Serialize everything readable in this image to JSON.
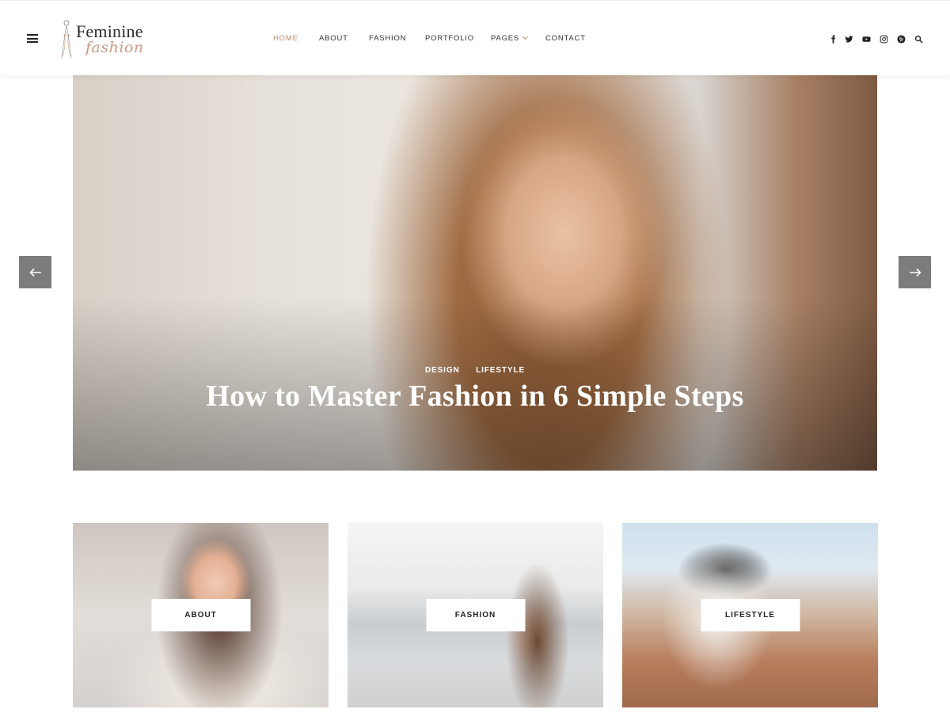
{
  "brand": {
    "name_line1": "Feminine",
    "name_line2": "fashion",
    "accent_color": "#c58b68"
  },
  "header": {
    "menu_icon": "hamburger-menu-icon",
    "nav": [
      {
        "label": "HOME",
        "active": true
      },
      {
        "label": "ABOUT",
        "active": false
      },
      {
        "label": "FASHION",
        "active": false
      },
      {
        "label": "PORTFOLIO",
        "active": false
      },
      {
        "label": "PAGES",
        "active": false,
        "has_dropdown": true
      },
      {
        "label": "CONTACT",
        "active": false
      }
    ],
    "social_icons": [
      "facebook-icon",
      "twitter-icon",
      "youtube-icon",
      "instagram-icon",
      "pinterest-icon",
      "search-icon"
    ]
  },
  "hero": {
    "categories": [
      "DESIGN",
      "LIFESTYLE"
    ],
    "title": "How to Master Fashion in 6 Simple Steps",
    "prev_icon": "arrow-left-icon",
    "next_icon": "arrow-right-icon"
  },
  "cards": [
    {
      "label": "ABOUT"
    },
    {
      "label": "FASHION"
    },
    {
      "label": "LIFESTYLE"
    }
  ]
}
